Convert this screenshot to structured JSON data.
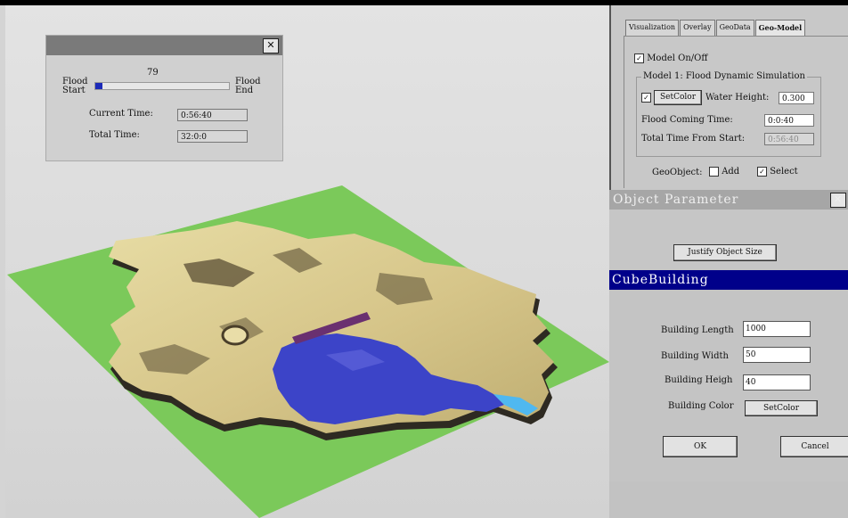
{
  "flood_dialog": {
    "close": "✕",
    "value_label": "79",
    "start_label_1": "Flood",
    "start_label_2": "Start",
    "end_label_1": "Flood",
    "end_label_2": "End",
    "progress": 0.05,
    "current_time_label": "Current Time:",
    "current_time_value": "0:56:40",
    "total_time_label": "Total Time:",
    "total_time_value": "32:0:0"
  },
  "tabs": [
    {
      "label": "Visualization"
    },
    {
      "label": "Overlay"
    },
    {
      "label": "GeoData"
    },
    {
      "label": "Geo-Model"
    }
  ],
  "model_panel": {
    "model_onoff_label": "Model On/Off",
    "model_onoff_checked": "✓",
    "group_title": "Model 1: Flood Dynamic Simulation",
    "set_color_check": "✓",
    "set_color_button": "SetColor",
    "water_height_label": "Water Height:",
    "water_height_value": "0.300",
    "coming_time_label": "Flood Coming Time:",
    "coming_time_value": "0:0:40",
    "total_time_label": "Total Time From Start:",
    "total_time_value": "0:56:40",
    "geoobject_label": "GeoObject:",
    "add_label": "Add",
    "add_checked": "",
    "select_label": "Select",
    "select_checked": "✓"
  },
  "object_parameter": {
    "title": "Object Parameter",
    "close": "✕",
    "justify_button": "Justify Object Size"
  },
  "cube_building": {
    "title": "CubeBuilding",
    "length_label": "Building Length",
    "length_value": "1000",
    "width_label": "Building Width",
    "width_value": "50",
    "height_label": "Building Heigh",
    "height_value": "40",
    "color_label": "Building Color",
    "setcolor_button": "SetColor",
    "ok_button": "OK",
    "cancel_button": "Cancel"
  },
  "colors": {
    "ground": "#7bc95a",
    "terrain": "#d8c98a",
    "water": "#3c44c8",
    "building": "#6a3070",
    "title_active": "#00008a"
  }
}
